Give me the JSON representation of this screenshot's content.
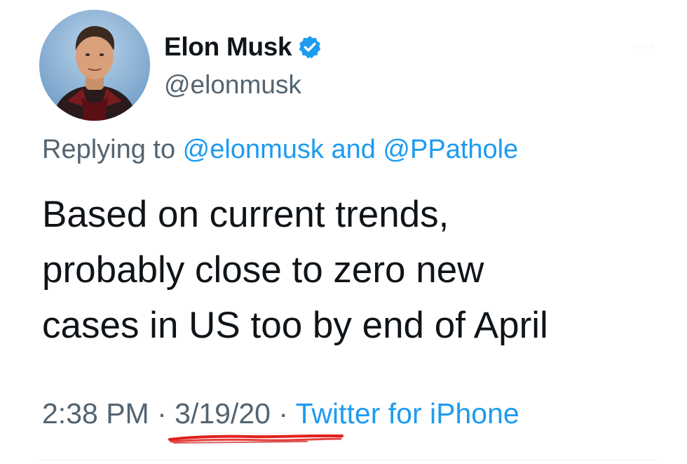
{
  "user": {
    "display_name": "Elon Musk",
    "handle": "@elonmusk",
    "verified": true,
    "avatar_icon": "profile-photo"
  },
  "reply": {
    "prefix": "Replying to ",
    "mention_1": "@elonmusk",
    "joiner": " and ",
    "mention_2": "@PPathole"
  },
  "tweet": {
    "lines": [
      "Based on current trends,",
      "probably close to zero new",
      "cases in US too by end of April"
    ]
  },
  "meta": {
    "time": "2:38 PM",
    "sep_1": " · ",
    "date": "3/19/20",
    "sep_2": " · ",
    "source": "Twitter for iPhone"
  },
  "colors": {
    "text": "#0f1419",
    "secondary": "#536471",
    "link": "#1d9bf0",
    "verified_badge": "#1d9bf0",
    "annotation": "#e0201b"
  },
  "annotation": {
    "type": "red-underline",
    "target": "date"
  }
}
